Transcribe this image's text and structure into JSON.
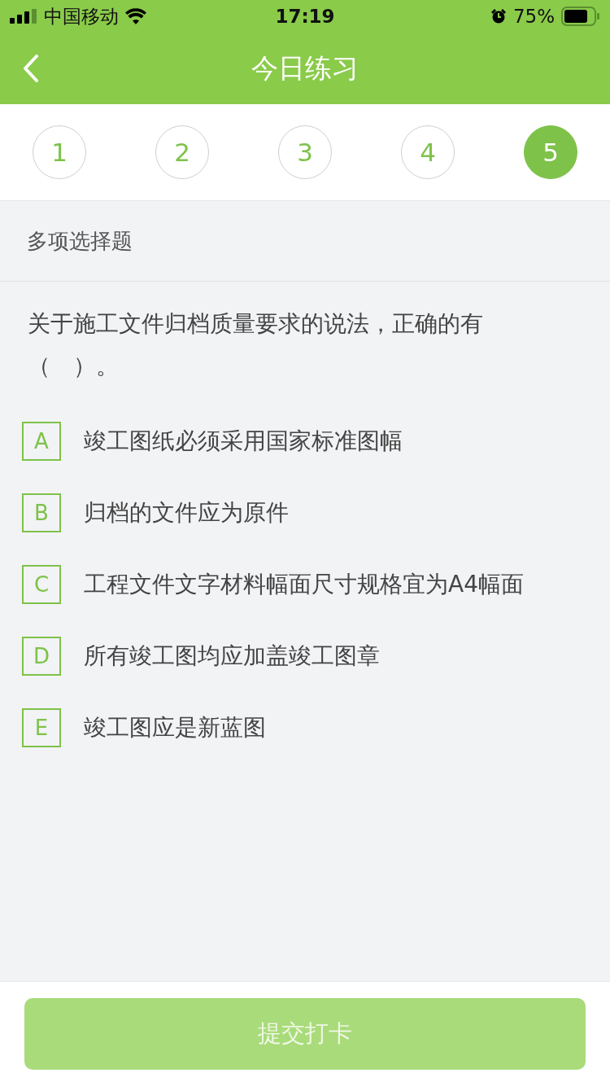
{
  "status_bar": {
    "carrier": "中国移动",
    "time": "17:19",
    "battery": "75%"
  },
  "header": {
    "title": "今日练习"
  },
  "steps": [
    {
      "label": "1",
      "selected": false
    },
    {
      "label": "2",
      "selected": false
    },
    {
      "label": "3",
      "selected": false
    },
    {
      "label": "4",
      "selected": false
    },
    {
      "label": "5",
      "selected": true
    }
  ],
  "question": {
    "type": "多项选择题",
    "text": "关于施工文件归档质量要求的说法，正确的有（　）。",
    "options": [
      {
        "letter": "A",
        "text": "竣工图纸必须采用国家标准图幅",
        "selected": false
      },
      {
        "letter": "B",
        "text": "归档的文件应为原件",
        "selected": false
      },
      {
        "letter": "C",
        "text": "工程文件文字材料幅面尺寸规格宜为A4幅面",
        "selected": false
      },
      {
        "letter": "D",
        "text": "所有竣工图均应加盖竣工图章",
        "selected": false
      },
      {
        "letter": "E",
        "text": "竣工图应是新蓝图",
        "selected": false
      }
    ]
  },
  "submit": {
    "label": "提交打卡",
    "disabled": true
  }
}
